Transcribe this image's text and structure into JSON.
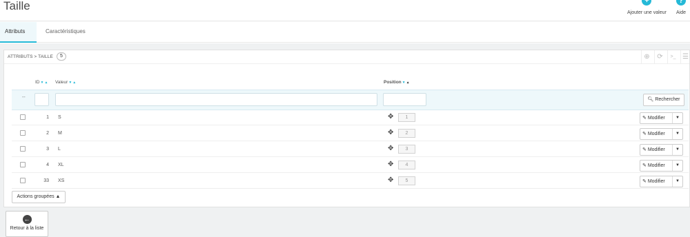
{
  "header": {
    "title": "Taille",
    "toolbar": [
      {
        "label": "Ajouter une valeur",
        "icon": "plus-circle-icon"
      },
      {
        "label": "Aide",
        "icon": "question-circle-icon"
      }
    ]
  },
  "tabs": [
    {
      "label": "Attributs",
      "active": true
    },
    {
      "label": "Caractéristiques",
      "active": false
    }
  ],
  "panel": {
    "title": "Attributs > Taille",
    "count": "5",
    "columns": {
      "id": "ID",
      "value": "Valeur",
      "position": "Position"
    },
    "filter_placeholder": "--",
    "search_label": "Rechercher",
    "rows": [
      {
        "id": "1",
        "value": "S",
        "position": "1",
        "action": "Modifier"
      },
      {
        "id": "2",
        "value": "M",
        "position": "2",
        "action": "Modifier"
      },
      {
        "id": "3",
        "value": "L",
        "position": "3",
        "action": "Modifier"
      },
      {
        "id": "4",
        "value": "XL",
        "position": "4",
        "action": "Modifier"
      },
      {
        "id": "33",
        "value": "XS",
        "position": "5",
        "action": "Modifier"
      }
    ],
    "bulk_actions_label": "Actions groupées",
    "back_label": "Retour à la liste"
  },
  "colors": {
    "accent": "#25b9d7",
    "background": "#eff1f2"
  }
}
